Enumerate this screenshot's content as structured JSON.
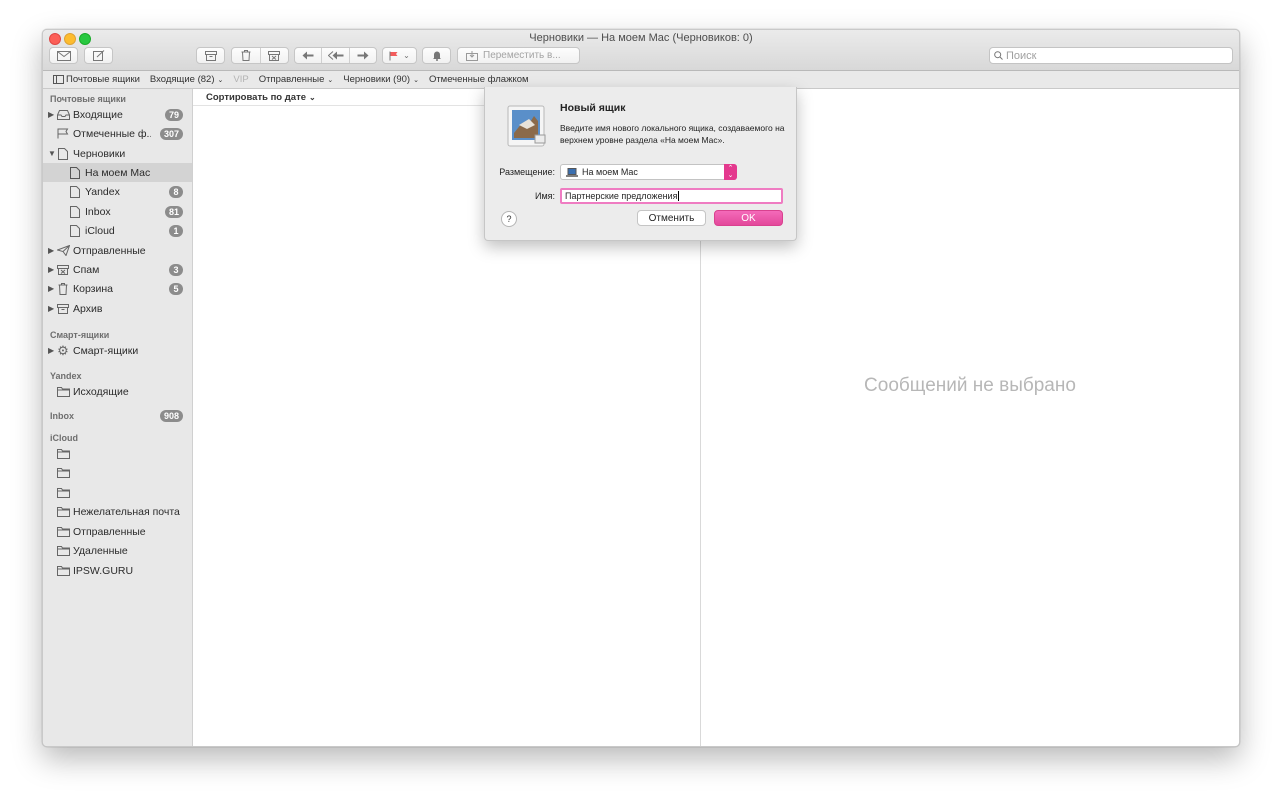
{
  "window": {
    "title": "Черновики — На моем Mac (Черновиков: 0)"
  },
  "toolbar": {
    "move_to_label": "Переместить в...",
    "search_placeholder": "Поиск"
  },
  "favorites": {
    "mailboxes": "Почтовые ящики",
    "inbox": "Входящие (82)",
    "vip": "VIP",
    "sent": "Отправленные",
    "drafts": "Черновики (90)",
    "flagged": "Отмеченные флажком"
  },
  "sidebar": {
    "sections": {
      "mailboxes": "Почтовые ящики",
      "smart": "Смарт-ящики",
      "yandex": "Yandex",
      "inbox": "Inbox",
      "icloud": "iCloud"
    },
    "inbox_section_badge": "908",
    "items": [
      {
        "label": "Входящие",
        "badge": "79"
      },
      {
        "label": "Отмеченные ф...",
        "badge": "307"
      },
      {
        "label": "Черновики",
        "badge": ""
      },
      {
        "label": "На моем Mac",
        "badge": ""
      },
      {
        "label": "Yandex",
        "badge": "8"
      },
      {
        "label": "Inbox",
        "badge": "81"
      },
      {
        "label": "iCloud",
        "badge": "1"
      },
      {
        "label": "Отправленные",
        "badge": ""
      },
      {
        "label": "Спам",
        "badge": "3"
      },
      {
        "label": "Корзина",
        "badge": "5"
      },
      {
        "label": "Архив",
        "badge": ""
      },
      {
        "label": "Смарт-ящики",
        "badge": ""
      },
      {
        "label": "Исходящие",
        "badge": ""
      },
      {
        "label": "Нежелательная почта",
        "badge": ""
      },
      {
        "label": "Отправленные",
        "badge": ""
      },
      {
        "label": "Удаленные",
        "badge": ""
      },
      {
        "label": "IPSW.GURU",
        "badge": ""
      }
    ]
  },
  "message_list": {
    "sort_label": "Сортировать по дате"
  },
  "viewer": {
    "empty_text": "Сообщений не выбрано"
  },
  "dialog": {
    "title": "Новый ящик",
    "description": "Введите имя нового локального ящика, создаваемого на верхнем уровне раздела «На моем Mac».",
    "location_label": "Размещение:",
    "location_value": "На моем Mac",
    "name_label": "Имя:",
    "name_value": "Партнерские предложения",
    "help": "?",
    "cancel_label": "Отменить",
    "ok_label": "OK"
  },
  "colors": {
    "accent": "#e4398e",
    "badge": "#8c8c8c"
  }
}
